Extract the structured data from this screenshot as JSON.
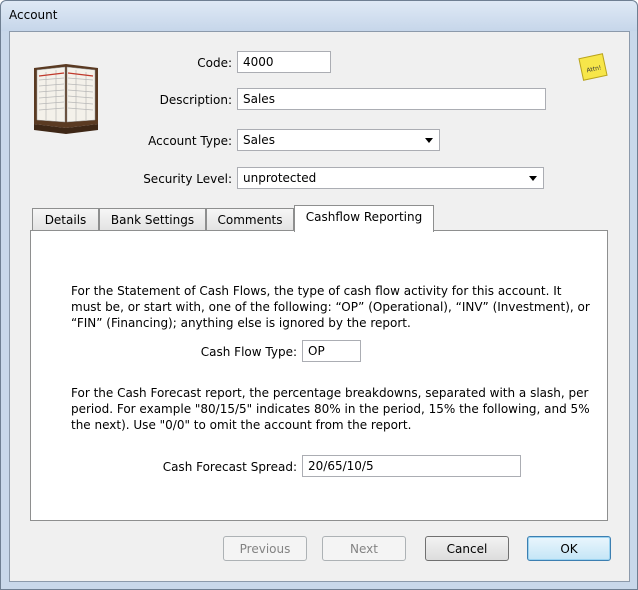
{
  "window": {
    "title": "Account"
  },
  "icons": {
    "book": "account-book-icon",
    "note": "sticky-note-icon",
    "note_text": "Attn!"
  },
  "fields": {
    "code": {
      "label": "Code:",
      "value": "4000"
    },
    "description": {
      "label": "Description:",
      "value": "Sales"
    },
    "account_type": {
      "label": "Account Type:",
      "value": "Sales"
    },
    "security_level": {
      "label": "Security Level:",
      "value": "unprotected"
    }
  },
  "tabs": [
    {
      "label": "Details"
    },
    {
      "label": "Bank Settings"
    },
    {
      "label": "Comments"
    },
    {
      "label": "Cashflow Reporting",
      "active": true
    }
  ],
  "cashflow": {
    "statement_text": "For the Statement of Cash Flows, the type of cash flow activity for this account. It must be, or start with, one of the following: “OP” (Operational), “INV” (Investment), or “FIN” (Financing); anything else is ignored by the report.",
    "flow_type_label": "Cash Flow Type:",
    "flow_type_value": "OP",
    "forecast_text": "For the Cash Forecast report, the percentage breakdowns, separated with a slash, per period. For example \"80/15/5\" indicates 80% in the period, 15% the following, and 5% the next). Use \"0/0\" to omit the account from the report.",
    "forecast_label": "Cash Forecast Spread:",
    "forecast_value": "20/65/10/5"
  },
  "buttons": {
    "previous": "Previous",
    "next": "Next",
    "cancel": "Cancel",
    "ok": "OK"
  }
}
